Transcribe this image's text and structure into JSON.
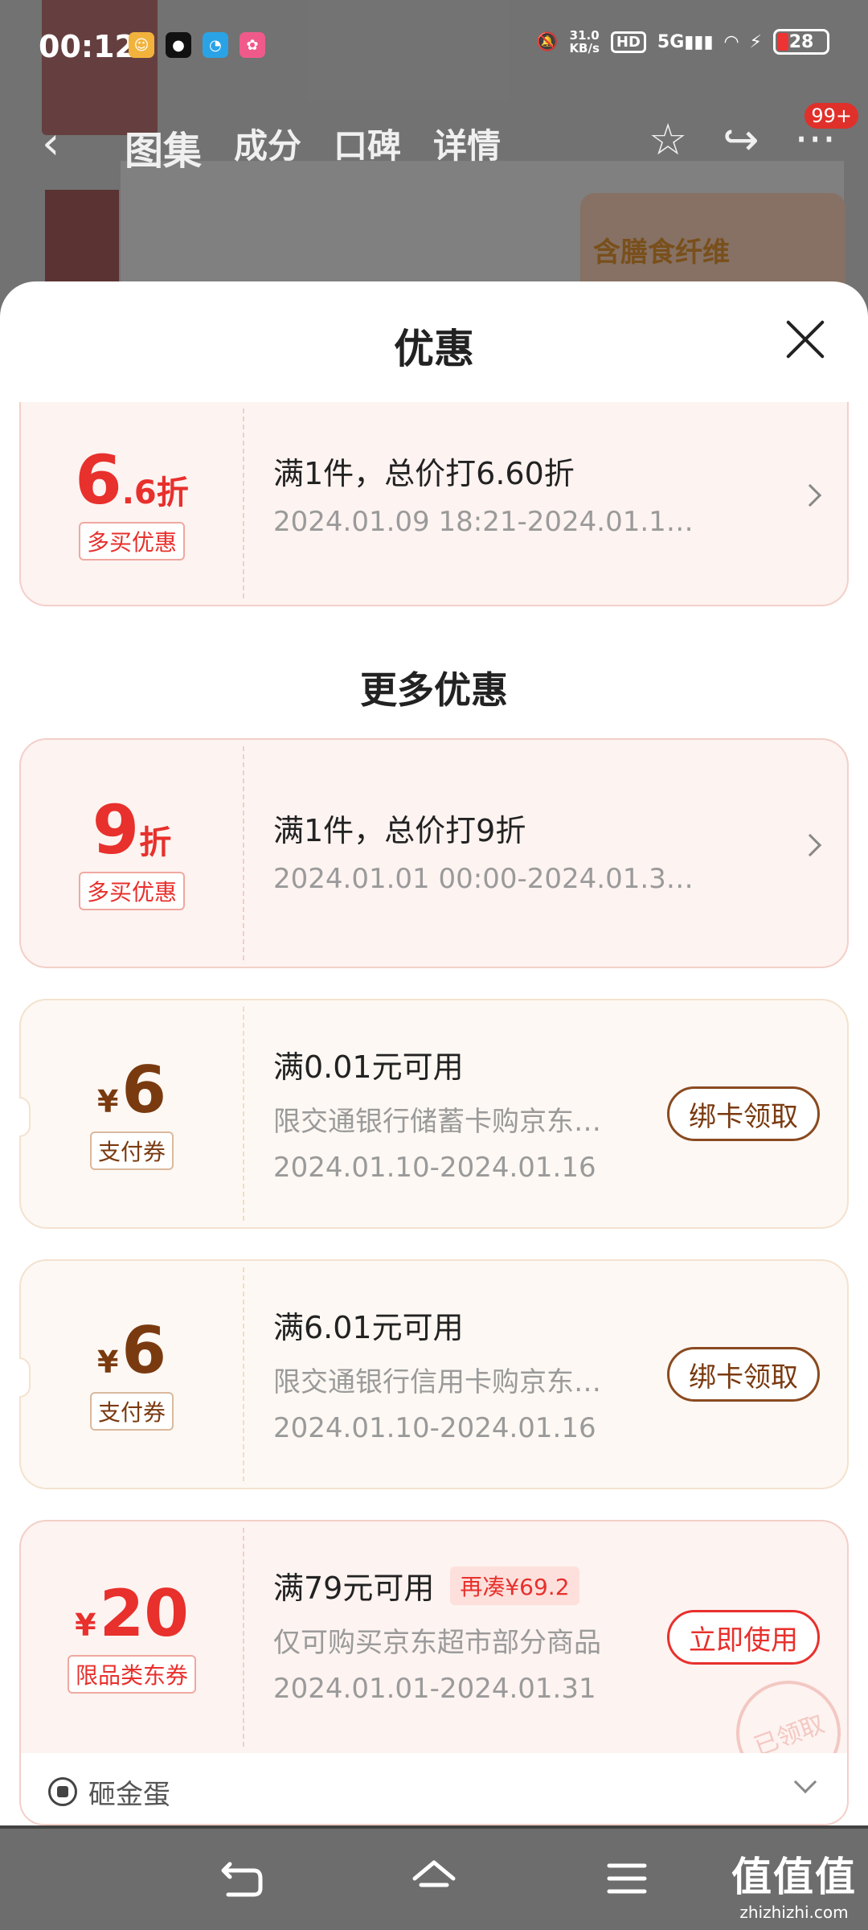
{
  "status_bar": {
    "time": "00:12",
    "net_speed_value": "31.0",
    "net_speed_unit": "KB/s",
    "hd": "HD",
    "signal": "5G",
    "battery": "28"
  },
  "top_nav": {
    "tabs": [
      "图集",
      "成分",
      "口碑",
      "详情"
    ],
    "badge": "99+"
  },
  "background": {
    "product_text": "含膳食纤维"
  },
  "sheet": {
    "title": "优惠",
    "more_title": "更多优惠"
  },
  "offers": [
    {
      "discount_int": "6",
      "discount_dec": ".6",
      "discount_unit": "折",
      "tag": "多买优惠",
      "title": "满1件，总价打6.60折",
      "period": "2024.01.09 18:21-2024.01.1…"
    }
  ],
  "more_offers": [
    {
      "discount_int": "9",
      "discount_unit": "折",
      "tag": "多买优惠",
      "title": "满1件，总价打9折",
      "period": "2024.01.01 00:00-2024.01.3…"
    }
  ],
  "coupons": [
    {
      "currency": "¥",
      "amount": "6",
      "tag": "支付券",
      "title": "满0.01元可用",
      "desc": "限交通银行储蓄卡购京东…",
      "period": "2024.01.10-2024.01.16",
      "action": "绑卡领取"
    },
    {
      "currency": "¥",
      "amount": "6",
      "tag": "支付券",
      "title": "满6.01元可用",
      "desc": "限交通银行信用卡购京东…",
      "period": "2024.01.10-2024.01.16",
      "action": "绑卡领取"
    },
    {
      "currency": "¥",
      "amount": "20",
      "tag": "限品类东券",
      "title": "满79元可用",
      "chip": "再凑¥69.2",
      "desc": "仅可购买京东超市部分商品",
      "period": "2024.01.01-2024.01.31",
      "action": "立即使用",
      "stamp": "已领取"
    }
  ],
  "egg": {
    "label": "砸金蛋"
  },
  "watermark": {
    "brand": "值值值",
    "domain": "zhizhizhi.com"
  },
  "colors": {
    "accent_red": "#e8302c",
    "coupon_brown": "#7a3a10",
    "card_pink_bg": "#fdf3f1",
    "card_cream_bg": "#fdf8f3"
  }
}
